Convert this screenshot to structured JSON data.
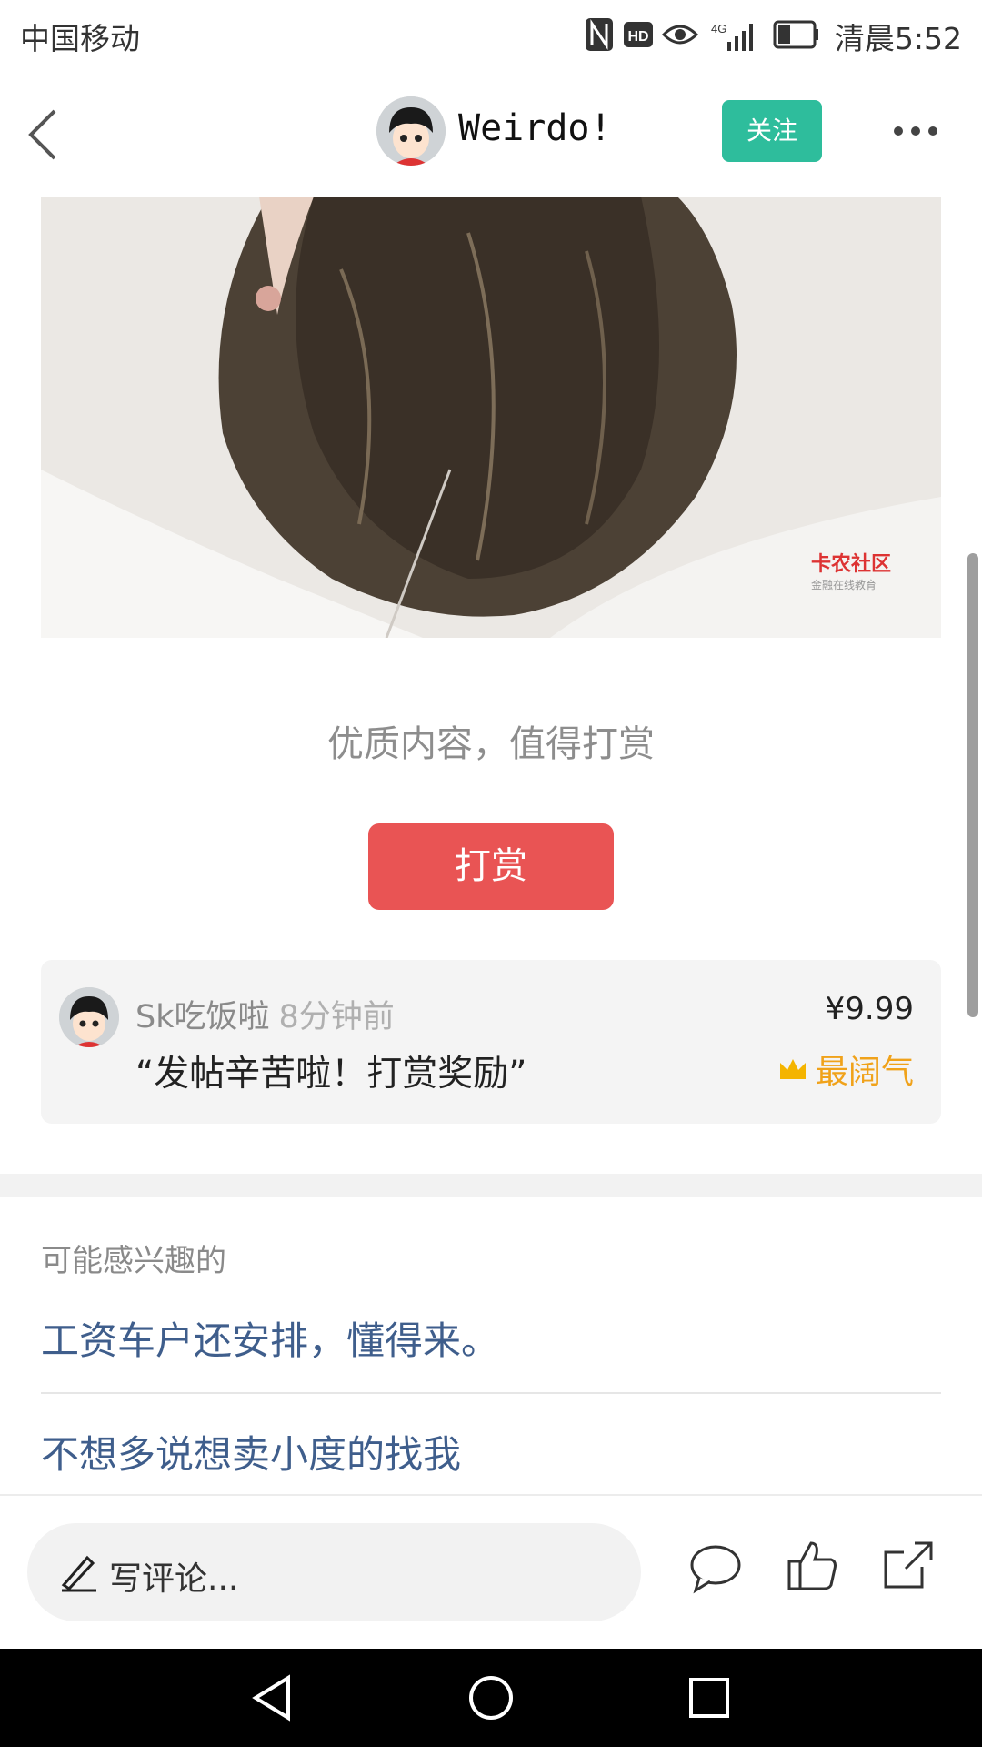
{
  "status_bar": {
    "carrier": "中国移动",
    "network_label": "4G",
    "hd_label": "HD",
    "time": "清晨5:52",
    "battery_level": 0.35
  },
  "header": {
    "author_name": "Weirdo!",
    "follow_label": "关注",
    "accent_color": "#2ebd9c"
  },
  "post": {
    "watermark": "卡农社区",
    "watermark_sub": "金融在线教育"
  },
  "reward": {
    "prompt": "优质内容，值得打赏",
    "button_label": "打赏",
    "button_color": "#e95454",
    "record": {
      "user": "Sk吃饭啦",
      "time": "8分钟前",
      "message": "“发帖辛苦啦！打赏奖励”",
      "amount": "¥9.99",
      "badge": "最阔气",
      "badge_color": "#f0a21a"
    }
  },
  "recommendations": {
    "title": "可能感兴趣的",
    "items": [
      "工资车户还安排，懂得来。",
      "不想多说想卖小度的找我"
    ],
    "link_color": "#3f5e8c"
  },
  "bottom_bar": {
    "comment_placeholder": "写评论..."
  },
  "icons": {
    "back": "chevron-left-icon",
    "more": "more-dots-icon",
    "pen": "pen-icon",
    "comment": "comment-bubble-icon",
    "like": "thumbs-up-icon",
    "share": "share-icon",
    "crown": "crown-icon"
  }
}
